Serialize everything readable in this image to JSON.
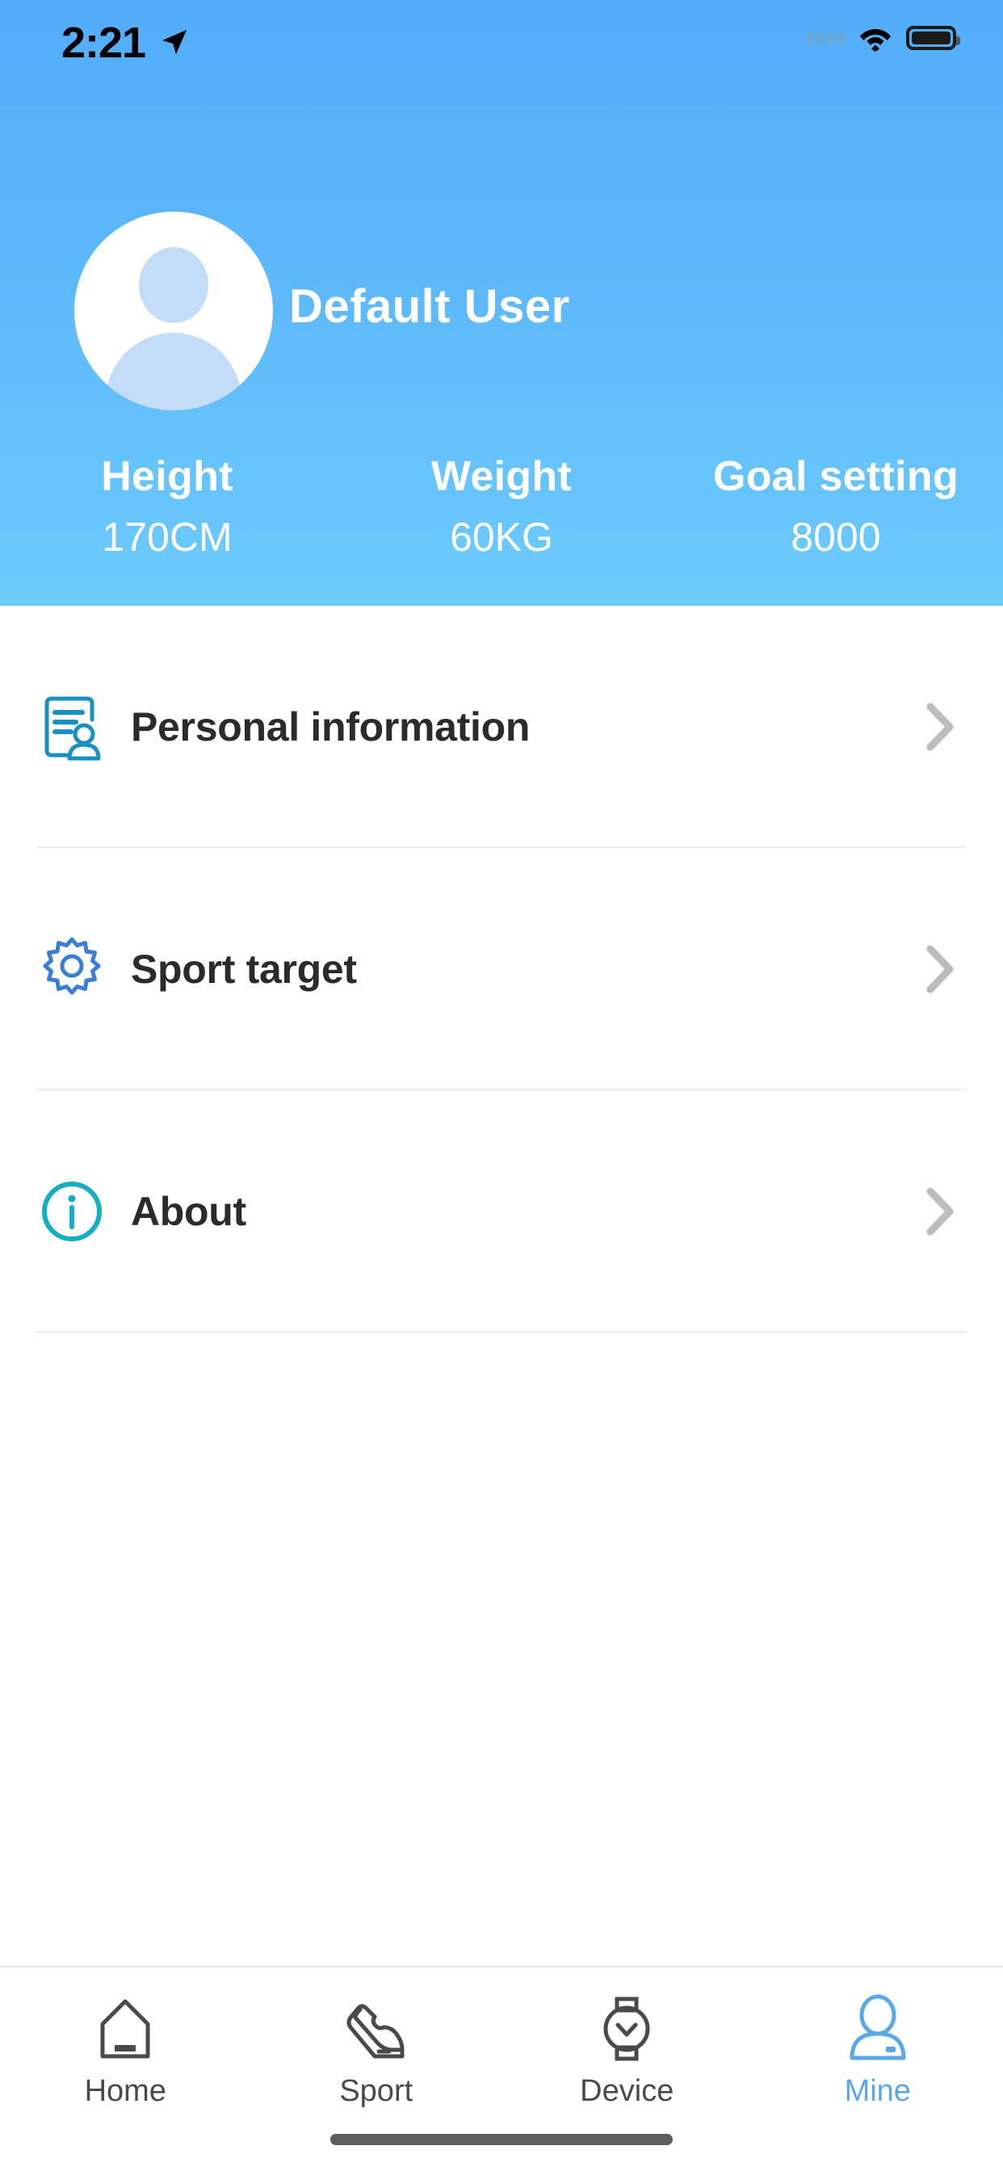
{
  "statusbar": {
    "time": "2:21",
    "location_icon": "location-arrow-icon",
    "signal_icon": "signal-dots-icon",
    "wifi_icon": "wifi-icon",
    "battery_icon": "battery-full-icon"
  },
  "header": {
    "avatar_icon": "default-avatar-icon",
    "username": "Default User",
    "background_color": "#5db8fa",
    "stats": [
      {
        "label": "Height",
        "value": "170CM"
      },
      {
        "label": "Weight",
        "value": "60KG"
      },
      {
        "label": "Goal setting",
        "value": "8000"
      }
    ]
  },
  "menu": {
    "items": [
      {
        "label": "Personal information",
        "icon": "document-person-icon",
        "icon_color": "#1a8fc1",
        "chevron": "chevron-right-icon"
      },
      {
        "label": "Sport target",
        "icon": "gear-icon",
        "icon_color": "#3b7fd4",
        "chevron": "chevron-right-icon"
      },
      {
        "label": "About",
        "icon": "info-circle-icon",
        "icon_color": "#16aec2",
        "chevron": "chevron-right-icon"
      }
    ]
  },
  "tabbar": {
    "active_color": "#5ba8e8",
    "inactive_color": "#4a4a4a",
    "items": [
      {
        "label": "Home",
        "icon": "house-icon",
        "active": false
      },
      {
        "label": "Sport",
        "icon": "shoe-icon",
        "active": false
      },
      {
        "label": "Device",
        "icon": "watch-icon",
        "active": false
      },
      {
        "label": "Mine",
        "icon": "person-icon",
        "active": true
      }
    ]
  }
}
